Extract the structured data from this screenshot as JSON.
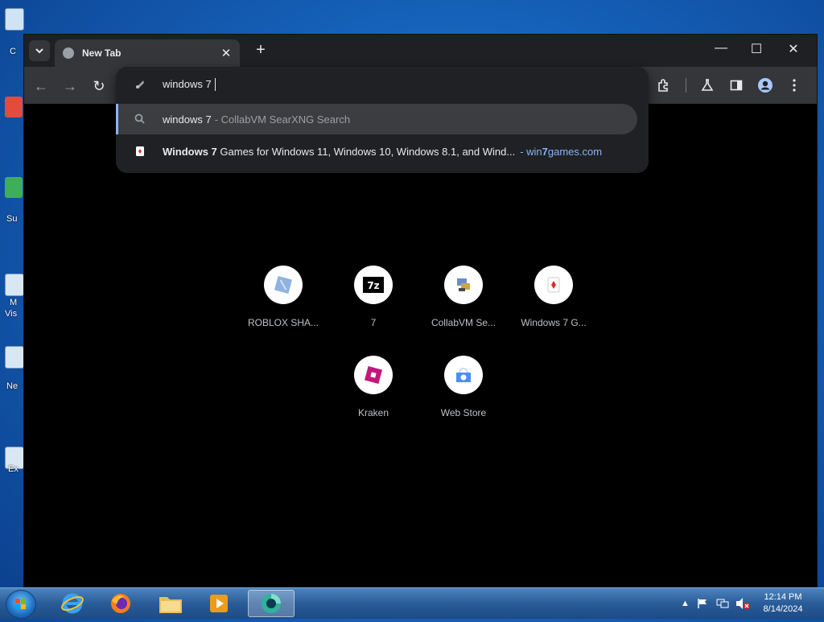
{
  "desktop": {
    "icon_labels": [
      "C",
      "Su",
      "M",
      "Vis",
      "Ne",
      "Ex"
    ]
  },
  "browser": {
    "tab": {
      "title": "New Tab"
    },
    "omnibox": {
      "value": "windows 7",
      "suggestions": [
        {
          "query": "windows 7",
          "suffix": "- CollabVM SearXNG Search"
        },
        {
          "bold": "Windows 7",
          "rest": "Games for Windows 11, Windows 10, Windows 8.1, and Wind...",
          "url_prefix": "- win",
          "url_bold": "7",
          "url_suffix": "games.com"
        }
      ]
    },
    "shortcuts": [
      {
        "name": "ROBLOX SHA...",
        "icon": "roblox-studio-icon"
      },
      {
        "name": "7",
        "icon": "7zip-icon"
      },
      {
        "name": "CollabVM Se...",
        "icon": "collabvm-icon"
      },
      {
        "name": "Windows 7 G...",
        "icon": "cards-icon"
      },
      {
        "name": "Kraken",
        "icon": "roblox-icon"
      },
      {
        "name": "Web Store",
        "icon": "web-store-icon"
      }
    ]
  },
  "taskbar": {
    "time": "12:14 PM",
    "date": "8/14/2024"
  }
}
